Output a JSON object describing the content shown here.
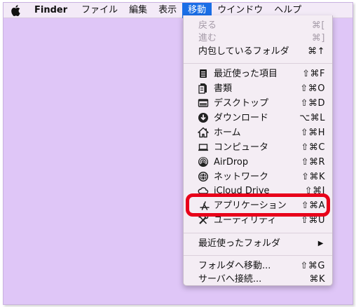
{
  "menubar": {
    "apple_icon": "apple-logo-icon",
    "app_name": "Finder",
    "items": [
      "ファイル",
      "編集",
      "表示",
      "移動",
      "ウインドウ",
      "ヘルプ"
    ],
    "active": "移動"
  },
  "menu": {
    "back": {
      "label": "戻る",
      "shortcut": "⌘["
    },
    "forward": {
      "label": "進む",
      "shortcut": "⌘]"
    },
    "enclosing": {
      "label": "内包しているフォルダ",
      "shortcut": "⌘↑"
    },
    "recents": {
      "label": "最近使った項目",
      "shortcut": "⇧⌘F",
      "icon": "recents-icon"
    },
    "documents": {
      "label": "書類",
      "shortcut": "⇧⌘O",
      "icon": "documents-icon"
    },
    "desktop": {
      "label": "デスクトップ",
      "shortcut": "⇧⌘D",
      "icon": "desktop-icon"
    },
    "downloads": {
      "label": "ダウンロード",
      "shortcut": "⌥⌘L",
      "icon": "download-icon"
    },
    "home": {
      "label": "ホーム",
      "shortcut": "⇧⌘H",
      "icon": "home-icon"
    },
    "computer": {
      "label": "コンピュータ",
      "shortcut": "⇧⌘C",
      "icon": "computer-icon"
    },
    "airdrop": {
      "label": "AirDrop",
      "shortcut": "⇧⌘R",
      "icon": "airdrop-icon"
    },
    "network": {
      "label": "ネットワーク",
      "shortcut": "⇧⌘K",
      "icon": "network-icon"
    },
    "icloud": {
      "label": "iCloud Drive",
      "shortcut": "⇧⌘I",
      "icon": "icloud-icon"
    },
    "applications": {
      "label": "アプリケーション",
      "shortcut": "⇧⌘A",
      "icon": "applications-icon"
    },
    "utilities": {
      "label": "ユーティリティ",
      "shortcut": "⇧⌘U",
      "icon": "utilities-icon"
    },
    "recent_folders": {
      "label": "最近使ったフォルダ",
      "submenu_icon": "▶"
    },
    "goto_folder": {
      "label": "フォルダへ移動...",
      "shortcut": "⇧⌘G"
    },
    "connect_server": {
      "label": "サーバへ接続...",
      "shortcut": "⌘K"
    }
  },
  "colors": {
    "desktop": "#dfc6f7",
    "active_menu": "#1a6ee6",
    "highlight": "#e8001a"
  }
}
